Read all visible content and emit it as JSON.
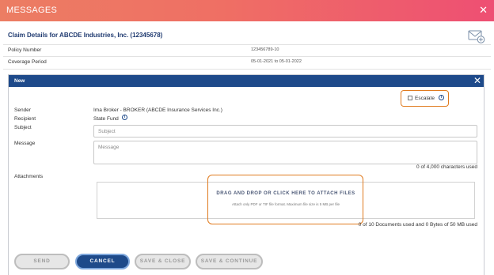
{
  "window": {
    "title": "MESSAGES"
  },
  "claim": {
    "title": "Claim Details for ABCDE Industries, Inc. (12345678)",
    "policy_number_label": "Policy Number",
    "policy_number_value": "123456789-10",
    "coverage_period_label": "Coverage Period",
    "coverage_period_value": "05-01-2021 to 05-01-2022"
  },
  "new_message": {
    "header_label": "New",
    "escalate_label": "Escalate",
    "sender_label": "Sender",
    "sender_value": "Ima Broker - BROKER (ABCDE Insurance Services Inc.)",
    "recipient_label": "Recipient",
    "recipient_value": "State Fund",
    "subject_label": "Subject",
    "subject_placeholder": "Subject",
    "subject_value": "",
    "message_label": "Message",
    "message_placeholder": "Message",
    "message_value": "",
    "char_count": "0 of 4,000 characters used",
    "attachments_label": "Attachments",
    "dropzone_title": "DRAG AND DROP OR CLICK HERE TO ATTACH FILES",
    "dropzone_subtitle": "Attach only PDF or TIF file format. Maximum file size is 5 MB per file",
    "documents_count": "0 of 10 Documents used and 0 Bytes of 50 MB used"
  },
  "buttons": {
    "send": "SEND",
    "cancel": "CANCEL",
    "save_close": "SAVE & CLOSE",
    "save_continue": "SAVE & CONTINUE"
  },
  "icons": {
    "close": "close-icon",
    "new_message": "envelope-plus-icon",
    "info": "info-icon"
  },
  "colors": {
    "title_gradient_start": "#ec7d63",
    "title_gradient_end": "#ee4f73",
    "panel_header": "#1e4a8a",
    "highlight_outline": "#e07b1f"
  }
}
